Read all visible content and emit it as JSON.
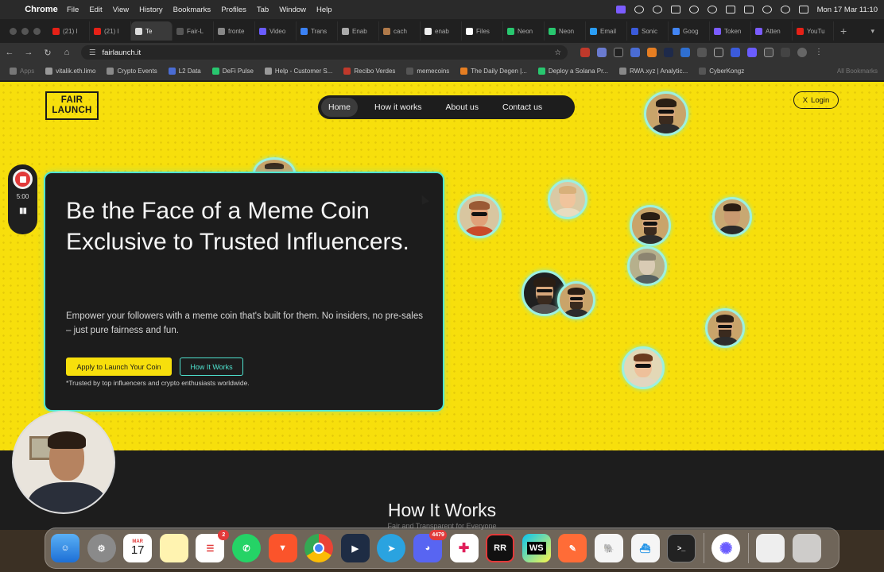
{
  "menubar": {
    "app_name": "Chrome",
    "menus": [
      "File",
      "Edit",
      "View",
      "History",
      "Bookmarks",
      "Profiles",
      "Tab",
      "Window",
      "Help"
    ],
    "datetime": "Mon 17 Mar  11:10"
  },
  "tabs": [
    {
      "label": "(21) I",
      "color": "#e62117"
    },
    {
      "label": "(21) I",
      "color": "#e62117"
    },
    {
      "label": "Te",
      "color": "#dddddd",
      "active": true
    },
    {
      "label": "Fair-L",
      "color": "#555555"
    },
    {
      "label": "fronte",
      "color": "#888888"
    },
    {
      "label": "Video",
      "color": "#6a5cff"
    },
    {
      "label": "Trans",
      "color": "#3b82f6"
    },
    {
      "label": "Enab",
      "color": "#aaaaaa"
    },
    {
      "label": "cach",
      "color": "#b07a4a"
    },
    {
      "label": "enab",
      "color": "#eeeeee"
    },
    {
      "label": "Files",
      "color": "#ffffff"
    },
    {
      "label": "Neon",
      "color": "#28c76f"
    },
    {
      "label": "Neon",
      "color": "#28c76f"
    },
    {
      "label": "Email",
      "color": "#2a9df4"
    },
    {
      "label": "Sonic",
      "color": "#3b5bdb"
    },
    {
      "label": "Goog",
      "color": "#4285f4"
    },
    {
      "label": "Token",
      "color": "#7b5cff"
    },
    {
      "label": "Atten",
      "color": "#7b5cff"
    },
    {
      "label": "YouTu",
      "color": "#e62117"
    }
  ],
  "address": {
    "url": "fairlaunch.it"
  },
  "bookmarks": [
    {
      "label": "Apps",
      "faded": true
    },
    {
      "label": "vitalik.eth.limo"
    },
    {
      "label": "Crypto Events"
    },
    {
      "label": "L2 Data"
    },
    {
      "label": "DeFi Pulse"
    },
    {
      "label": "Help - Customer S..."
    },
    {
      "label": "Recibo Verdes"
    },
    {
      "label": "memecoins"
    },
    {
      "label": "The Daily Degen |..."
    },
    {
      "label": "Deploy a Solana Pr..."
    },
    {
      "label": "RWA.xyz | Analytic..."
    },
    {
      "label": "CyberKongz"
    }
  ],
  "bookmarks_all": "All Bookmarks",
  "site": {
    "logo_line1": "FAIR",
    "logo_line2": "LAUNCH",
    "nav": [
      "Home",
      "How it works",
      "About us",
      "Contact us"
    ],
    "login_icon": "X",
    "login_label": "Login",
    "hero": {
      "headline": "Be the Face of a Meme Coin Exclusive to Trusted Influencers.",
      "description": "Empower your followers with a meme coin that's built for them. No insiders, no pre-sales – just pure fairness and fun.",
      "primary_cta": "Apply to Launch Your Coin",
      "secondary_cta": "How It Works",
      "note": "*Trusted by top influencers and crypto enthusiasts worldwide."
    },
    "section_title": "How It Works",
    "section_subtitle": "Fair and Transparent for Everyone"
  },
  "recorder": {
    "time": "5:00"
  },
  "dock": {
    "calendar_month": "MAR",
    "calendar_day": "17",
    "reminders_badge": "2",
    "discord_badge": "4479",
    "rubymine_label": "RR",
    "webstorm_label": "WS"
  }
}
